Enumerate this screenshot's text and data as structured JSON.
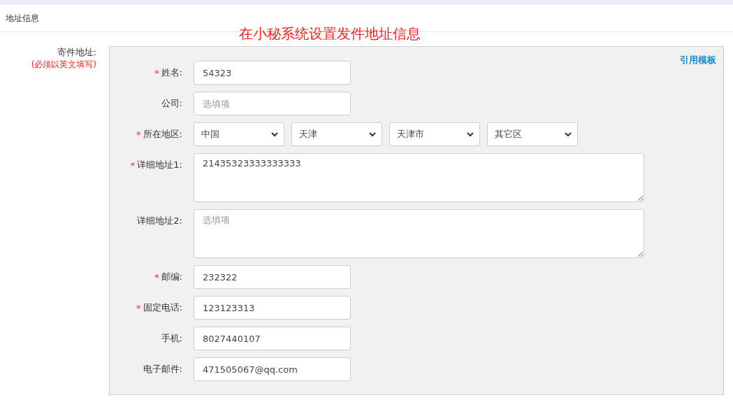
{
  "section_title": "地址信息",
  "annotation": "在小秘系统设置发件地址信息",
  "sender": {
    "label": "寄件地址:",
    "note": "(必须以英文填写)",
    "template_link": "引用模板",
    "fields": [
      {
        "kind": "input",
        "required_mark": "*",
        "label": "姓名:",
        "value": "54323"
      },
      {
        "kind": "input",
        "label": "公司:",
        "placeholder": "选填项"
      },
      {
        "kind": "selects",
        "required_mark": "*",
        "label": "所在地区:",
        "options": [
          "中国",
          "天津",
          "天津市",
          "其它区"
        ]
      },
      {
        "kind": "textarea",
        "required_mark": "*",
        "label": "详细地址1:",
        "value": "21435323333333333"
      },
      {
        "kind": "textarea",
        "label": "详细地址2:",
        "placeholder": "选填项"
      },
      {
        "kind": "input",
        "required_mark": "*",
        "label": "邮编:",
        "value": "232322"
      },
      {
        "kind": "input",
        "required_mark": "*",
        "label": "固定电话:",
        "value": "123123313"
      },
      {
        "kind": "input",
        "label": "手机:",
        "value": "8027440107"
      },
      {
        "kind": "input",
        "label": "电子邮件:",
        "value": "471505067@qq.com"
      }
    ]
  }
}
